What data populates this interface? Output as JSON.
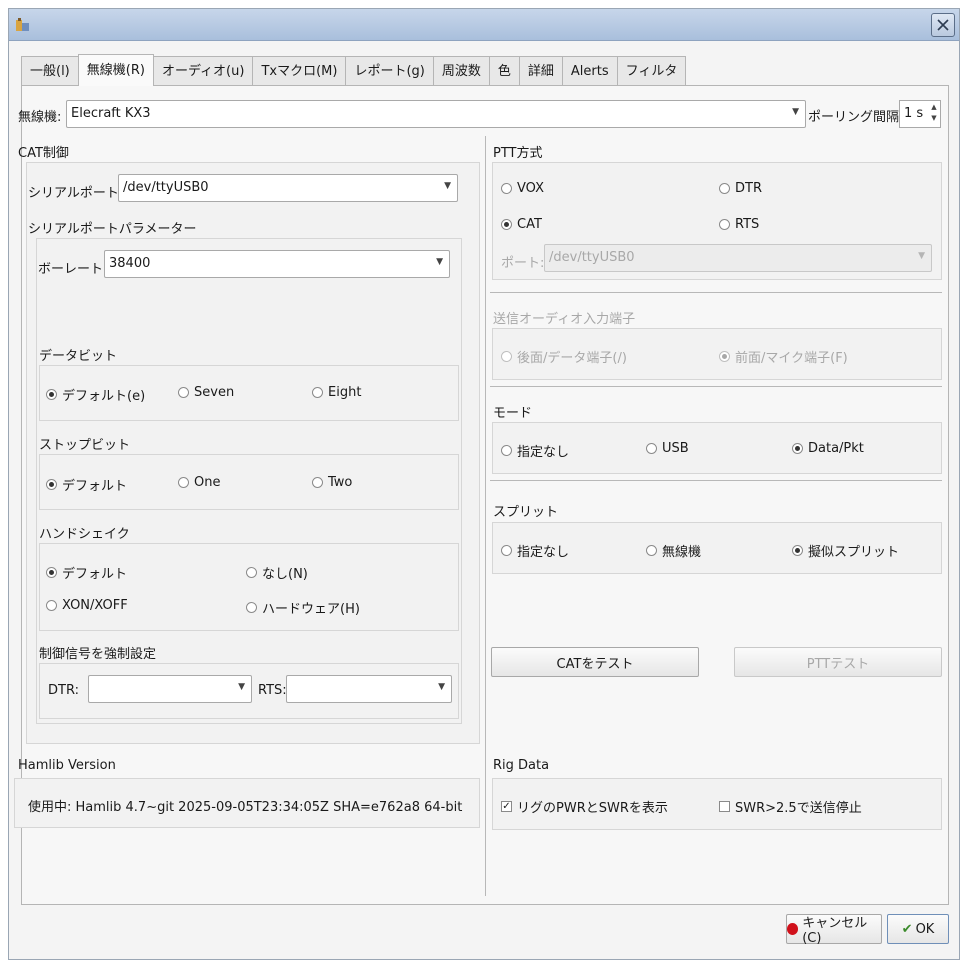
{
  "tabs": [
    "一般(l)",
    "無線機(R)",
    "オーディオ(u)",
    "Txマクロ(M)",
    "レポート(g)",
    "周波数",
    "色",
    "詳細",
    "Alerts",
    "フィルタ"
  ],
  "radio": {
    "label": "無線機:",
    "value": "Elecraft KX3"
  },
  "polling": {
    "label": "ポーリング間隔:",
    "value": "1 s"
  },
  "cat": {
    "title": "CAT制御",
    "serial_label": "シリアルポート:",
    "serial_value": "/dev/ttyUSB0",
    "params_title": "シリアルポートパラメーター",
    "baud_label": "ボーレート:",
    "baud_value": "38400",
    "databits": {
      "title": "データビット",
      "options": [
        "デフォルト(e)",
        "Seven",
        "Eight"
      ]
    },
    "stopbits": {
      "title": "ストップビット",
      "options": [
        "デフォルト",
        "One",
        "Two"
      ]
    },
    "handshake": {
      "title": "ハンドシェイク",
      "options": [
        "デフォルト",
        "なし(N)",
        "XON/XOFF",
        "ハードウェア(H)"
      ]
    },
    "force": {
      "title": "制御信号を強制設定",
      "dtr_label": "DTR:",
      "rts_label": "RTS:",
      "dtr_value": "",
      "rts_value": ""
    }
  },
  "ptt": {
    "title": "PTT方式",
    "options": [
      "VOX",
      "DTR",
      "CAT",
      "RTS"
    ],
    "port_label": "ポート:",
    "port_value": "/dev/ttyUSB0"
  },
  "audio_in": {
    "title": "送信オーディオ入力端子",
    "options": [
      "後面/データ端子(/)",
      "前面/マイク端子(F)"
    ]
  },
  "mode": {
    "title": "モード",
    "options": [
      "指定なし",
      "USB",
      "Data/Pkt"
    ]
  },
  "split": {
    "title": "スプリット",
    "options": [
      "指定なし",
      "無線機",
      "擬似スプリット"
    ]
  },
  "buttons": {
    "test_cat": "CATをテスト",
    "test_ptt": "PTTテスト",
    "cancel": "キャンセル(C)",
    "ok": "OK"
  },
  "hamlib": {
    "title": "Hamlib Version",
    "text": "使用中:  Hamlib 4.7~git 2025-09-05T23:34:05Z SHA=e762a8 64-bit"
  },
  "rigdata": {
    "title": "Rig Data",
    "options": [
      "リグのPWRとSWRを表示",
      "SWR>2.5で送信停止"
    ]
  },
  "colors": {
    "titlebar": "#b8cbe3",
    "cancel_icon": "#d0101a",
    "ok_icon": "#3a8a2a"
  }
}
